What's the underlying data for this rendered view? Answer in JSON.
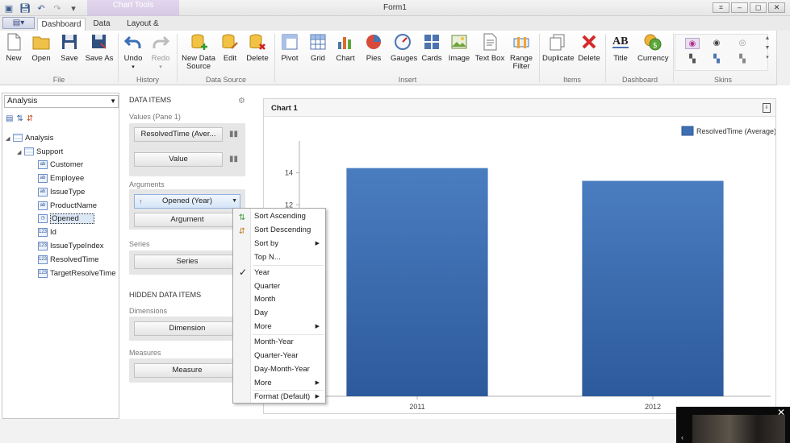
{
  "window": {
    "title": "Form1",
    "context_group": "Chart Tools",
    "buttons": {
      "restore": "⌗",
      "minimize": "–",
      "maximize": "◻",
      "close": "✕"
    }
  },
  "quick_access": {
    "icons": [
      "app-icon",
      "save-icon",
      "undo-icon",
      "redo-icon",
      "customize-icon"
    ]
  },
  "tabs": [
    {
      "label": "Dashboard",
      "active": true
    },
    {
      "label": "Data",
      "active": false
    },
    {
      "label": "Layout & Style",
      "active": false
    }
  ],
  "ribbon": {
    "groups": {
      "file": "File",
      "history": "History",
      "data_source": "Data Source",
      "insert": "Insert",
      "items": "Items",
      "dashboard": "Dashboard",
      "skins": "Skins"
    },
    "buttons": {
      "new": "New",
      "open": "Open",
      "save": "Save",
      "save_as": "Save As",
      "undo": "Undo",
      "redo": "Redo",
      "new_data_source_1": "New Data",
      "new_data_source_2": "Source",
      "edit": "Edit",
      "delete": "Delete",
      "pivot": "Pivot",
      "grid": "Grid",
      "chart": "Chart",
      "pies": "Pies",
      "gauges": "Gauges",
      "cards": "Cards",
      "image": "Image",
      "text_box": "Text Box",
      "range_filter_1": "Range",
      "range_filter_2": "Filter",
      "duplicate": "Duplicate",
      "delete_item": "Delete",
      "title": "Title",
      "currency": "Currency"
    }
  },
  "data_source": {
    "selected": "Analysis",
    "tree": {
      "root": "Analysis",
      "table": "Support",
      "fields": [
        {
          "name": "Customer",
          "type": "ab"
        },
        {
          "name": "Employee",
          "type": "ab"
        },
        {
          "name": "IssueType",
          "type": "ab"
        },
        {
          "name": "ProductName",
          "type": "ab"
        },
        {
          "name": "Opened",
          "type": "dt"
        },
        {
          "name": "Id",
          "type": "123"
        },
        {
          "name": "IssueTypeIndex",
          "type": "123"
        },
        {
          "name": "ResolvedTime",
          "type": "123"
        },
        {
          "name": "TargetResolveTime",
          "type": "123"
        }
      ]
    }
  },
  "data_items": {
    "title": "DATA ITEMS",
    "values_label": "Values (Pane 1)",
    "value_item": "ResolvedTime (Aver...",
    "value_placeholder": "Value",
    "arguments_label": "Arguments",
    "argument_item": "Opened (Year)",
    "argument_placeholder": "Argument",
    "series_label": "Series",
    "series_placeholder": "Series",
    "hidden_title": "HIDDEN DATA ITEMS",
    "dimensions_label": "Dimensions",
    "dimension_placeholder": "Dimension",
    "measures_label": "Measures",
    "measure_placeholder": "Measure"
  },
  "context_menu": {
    "items": {
      "sort_asc": "Sort Ascending",
      "sort_desc": "Sort Descending",
      "sort_by": "Sort by",
      "top_n": "Top N...",
      "year": "Year",
      "quarter": "Quarter",
      "month": "Month",
      "day": "Day",
      "more_1": "More",
      "month_year": "Month-Year",
      "quarter_year": "Quarter-Year",
      "day_month_year": "Day-Month-Year",
      "more_2": "More",
      "format": "Format (Default)"
    },
    "checked": "year"
  },
  "chart_panel": {
    "caption": "Chart 1"
  },
  "chart_data": {
    "type": "bar",
    "title": "Chart 1",
    "categories": [
      "2011",
      "2012"
    ],
    "series": [
      {
        "name": "ResolvedTime (Average)",
        "values": [
          14.3,
          13.5
        ],
        "color": "#3e6fb0"
      }
    ],
    "ylim": [
      0,
      16
    ],
    "yticks": [
      "12",
      "14"
    ],
    "xlabel": "",
    "ylabel": "",
    "legend": "top-right",
    "grid": false
  },
  "colors": {
    "bar_top": "#4a7dc0",
    "bar_bottom": "#2d5a9c",
    "accent": "#3e6fb0"
  }
}
